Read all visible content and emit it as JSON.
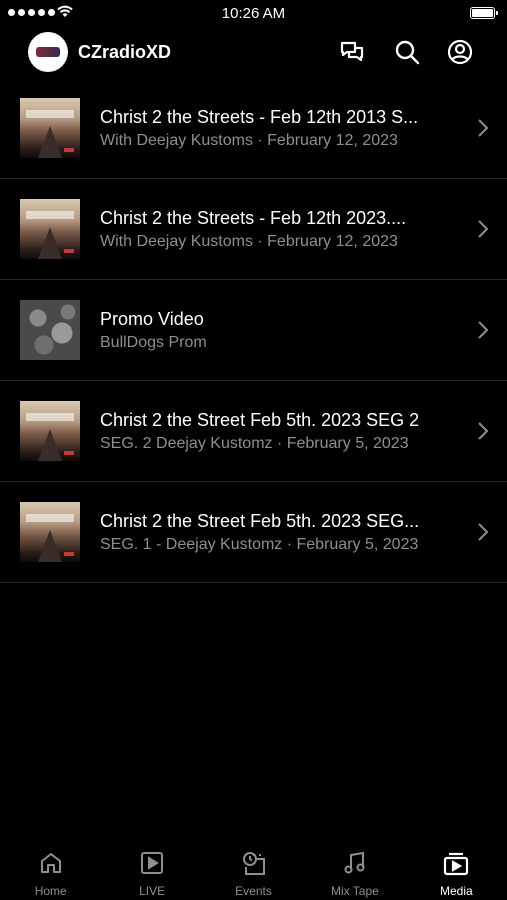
{
  "status_bar": {
    "time": "10:26 AM",
    "signal_bars": 5,
    "battery_level": 1.0
  },
  "header": {
    "title": "CZradioXD",
    "icons": [
      "chat-icon",
      "search-icon",
      "account-icon"
    ]
  },
  "items": [
    {
      "title": "Christ 2 the Streets - Feb 12th 2013 S...",
      "subtitle": "With Deejay Kustoms · February 12, 2023",
      "thumbnail": "poster"
    },
    {
      "title": "Christ 2 the Streets - Feb 12th 2023....",
      "subtitle": "With Deejay Kustoms · February 12, 2023",
      "thumbnail": "poster"
    },
    {
      "title": "Promo Video",
      "subtitle": "BullDogs Prom",
      "thumbnail": "promo"
    },
    {
      "title": "Christ 2 the Street Feb 5th. 2023 SEG 2",
      "subtitle": "SEG. 2 Deejay Kustomz · February 5, 2023",
      "thumbnail": "poster"
    },
    {
      "title": "Christ 2 the Street Feb 5th. 2023 SEG...",
      "subtitle": "SEG. 1 - Deejay Kustomz · February 5, 2023",
      "thumbnail": "poster"
    }
  ],
  "tabs": [
    {
      "label": "Home",
      "icon": "home-icon",
      "active": false
    },
    {
      "label": "LIVE",
      "icon": "play-icon",
      "active": false
    },
    {
      "label": "Events",
      "icon": "calendar-clock-icon",
      "active": false
    },
    {
      "label": "Mix Tape",
      "icon": "music-note-icon",
      "active": false
    },
    {
      "label": "Media",
      "icon": "media-icon",
      "active": true
    }
  ],
  "colors": {
    "background": "#000000",
    "text": "#ffffff",
    "secondary_text": "#8e8e93",
    "divider": "#262626"
  }
}
